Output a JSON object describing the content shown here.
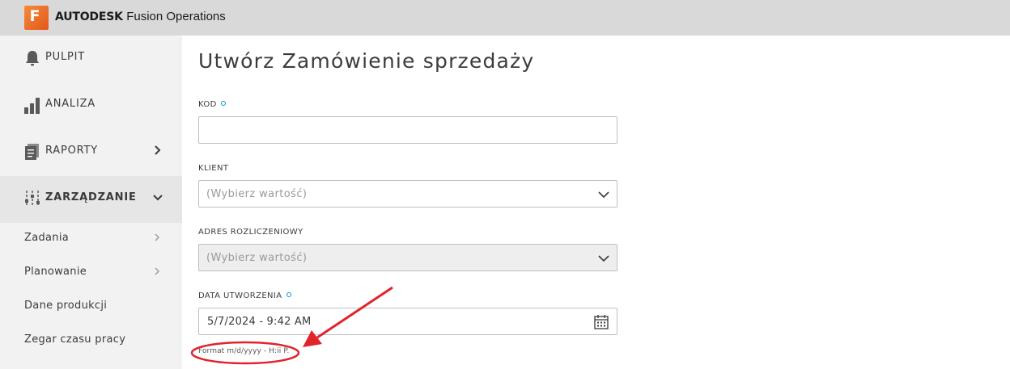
{
  "header": {
    "brand_bold": "AUTODESK",
    "brand_product": "Fusion Operations",
    "logo_letter": "F",
    "accent_color": "#e96a24"
  },
  "sidebar": {
    "items": [
      {
        "label": "PULPIT",
        "icon": "bell-icon"
      },
      {
        "label": "ANALIZA",
        "icon": "bar-chart-icon"
      },
      {
        "label": "RAPORTY",
        "icon": "reports-icon",
        "chevron": "chevron-right-icon"
      },
      {
        "label": "ZARZĄDZANIE",
        "icon": "sliders-icon",
        "chevron": "chevron-down-icon",
        "expanded": true
      }
    ],
    "subitems": [
      {
        "label": "Zadania",
        "chevron": true
      },
      {
        "label": "Planowanie",
        "chevron": true
      },
      {
        "label": "Dane produkcji",
        "chevron": false
      },
      {
        "label": "Zegar czasu pracy",
        "chevron": false
      }
    ]
  },
  "main": {
    "title": "Utwórz Zamówienie sprzedaży",
    "fields": {
      "kod": {
        "label": "KOD",
        "required": true,
        "value": ""
      },
      "klient": {
        "label": "KLIENT",
        "placeholder": "(Wybierz wartość)"
      },
      "adres": {
        "label": "ADRES ROZLICZENIOWY",
        "placeholder": "(Wybierz wartość)",
        "disabled": true
      },
      "data": {
        "label": "DATA UTWORZENIA",
        "required": true,
        "value": "5/7/2024 - 9:42 AM",
        "hint": "Format m/d/yyyy - H:ii P."
      }
    }
  },
  "annotation": {
    "color": "#e0242b"
  }
}
